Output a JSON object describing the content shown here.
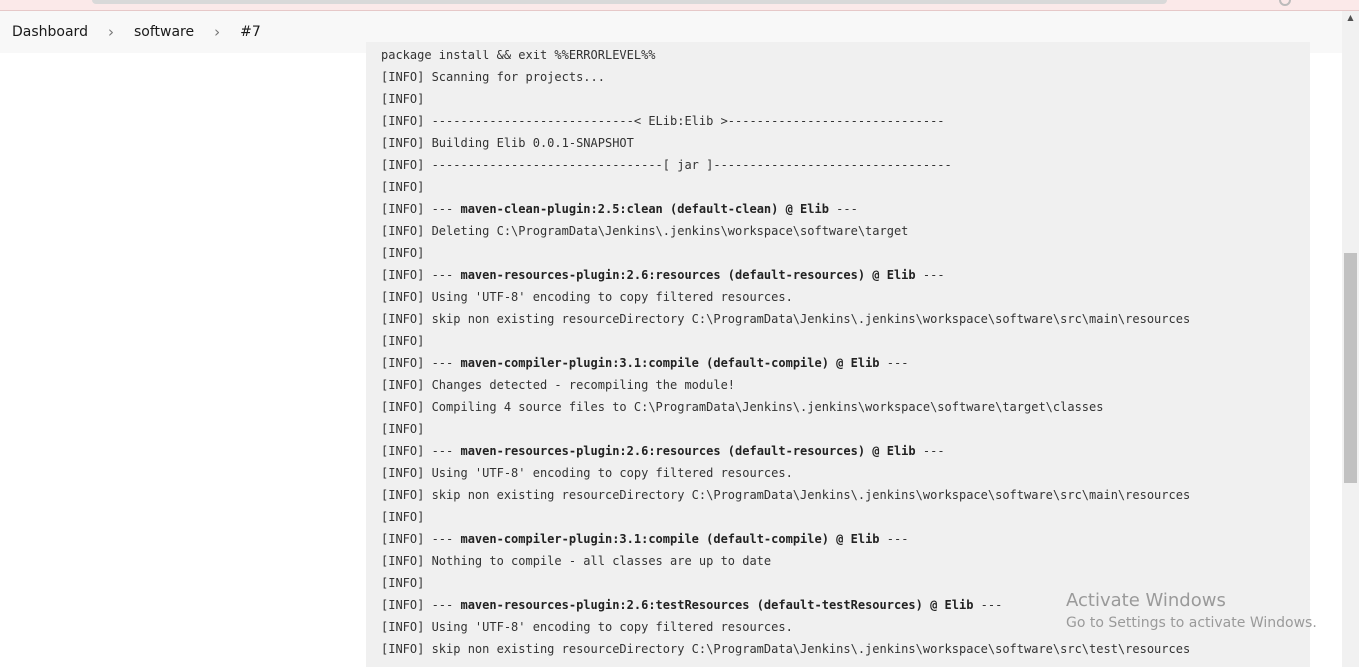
{
  "breadcrumb": {
    "items": [
      "Dashboard",
      "software",
      "#7"
    ],
    "separator": "›"
  },
  "console": {
    "lines": [
      {
        "prefix": "",
        "text": "package install && exit %%ERRORLEVEL%%",
        "bold": ""
      },
      {
        "prefix": "[INFO] ",
        "text": "Scanning for projects...",
        "bold": ""
      },
      {
        "prefix": "[INFO]",
        "text": "",
        "bold": ""
      },
      {
        "prefix": "[INFO] ",
        "text": "----------------------------< ELib:Elib >------------------------------",
        "bold": ""
      },
      {
        "prefix": "[INFO] ",
        "text": "Building Elib 0.0.1-SNAPSHOT",
        "bold": ""
      },
      {
        "prefix": "[INFO] ",
        "text": "--------------------------------[ jar ]---------------------------------",
        "bold": ""
      },
      {
        "prefix": "[INFO]",
        "text": "",
        "bold": ""
      },
      {
        "prefix": "[INFO] ",
        "text": "--- ",
        "bold": "maven-clean-plugin:2.5:clean (default-clean) @ Elib",
        "suffix": " ---"
      },
      {
        "prefix": "[INFO] ",
        "text": "Deleting C:\\ProgramData\\Jenkins\\.jenkins\\workspace\\software\\target",
        "bold": ""
      },
      {
        "prefix": "[INFO]",
        "text": "",
        "bold": ""
      },
      {
        "prefix": "[INFO] ",
        "text": "--- ",
        "bold": "maven-resources-plugin:2.6:resources (default-resources) @ Elib",
        "suffix": " ---"
      },
      {
        "prefix": "[INFO] ",
        "text": "Using 'UTF-8' encoding to copy filtered resources.",
        "bold": ""
      },
      {
        "prefix": "[INFO] ",
        "text": "skip non existing resourceDirectory C:\\ProgramData\\Jenkins\\.jenkins\\workspace\\software\\src\\main\\resources",
        "bold": ""
      },
      {
        "prefix": "[INFO]",
        "text": "",
        "bold": ""
      },
      {
        "prefix": "[INFO] ",
        "text": "--- ",
        "bold": "maven-compiler-plugin:3.1:compile (default-compile) @ Elib",
        "suffix": " ---"
      },
      {
        "prefix": "[INFO] ",
        "text": "Changes detected - recompiling the module!",
        "bold": ""
      },
      {
        "prefix": "[INFO] ",
        "text": "Compiling 4 source files to C:\\ProgramData\\Jenkins\\.jenkins\\workspace\\software\\target\\classes",
        "bold": ""
      },
      {
        "prefix": "[INFO]",
        "text": "",
        "bold": ""
      },
      {
        "prefix": "[INFO] ",
        "text": "--- ",
        "bold": "maven-resources-plugin:2.6:resources (default-resources) @ Elib",
        "suffix": " ---"
      },
      {
        "prefix": "[INFO] ",
        "text": "Using 'UTF-8' encoding to copy filtered resources.",
        "bold": ""
      },
      {
        "prefix": "[INFO] ",
        "text": "skip non existing resourceDirectory C:\\ProgramData\\Jenkins\\.jenkins\\workspace\\software\\src\\main\\resources",
        "bold": ""
      },
      {
        "prefix": "[INFO]",
        "text": "",
        "bold": ""
      },
      {
        "prefix": "[INFO] ",
        "text": "--- ",
        "bold": "maven-compiler-plugin:3.1:compile (default-compile) @ Elib",
        "suffix": " ---"
      },
      {
        "prefix": "[INFO] ",
        "text": "Nothing to compile - all classes are up to date",
        "bold": ""
      },
      {
        "prefix": "[INFO]",
        "text": "",
        "bold": ""
      },
      {
        "prefix": "[INFO] ",
        "text": "--- ",
        "bold": "maven-resources-plugin:2.6:testResources (default-testResources) @ Elib",
        "suffix": " ---"
      },
      {
        "prefix": "[INFO] ",
        "text": "Using 'UTF-8' encoding to copy filtered resources.",
        "bold": ""
      },
      {
        "prefix": "[INFO] ",
        "text": "skip non existing resourceDirectory C:\\ProgramData\\Jenkins\\.jenkins\\workspace\\software\\src\\test\\resources",
        "bold": ""
      }
    ]
  },
  "watermark": {
    "title": "Activate Windows",
    "subtitle": "Go to Settings to activate Windows."
  },
  "scrollbar": {
    "up_arrow": "▲",
    "scroll_fraction": 0.37
  }
}
